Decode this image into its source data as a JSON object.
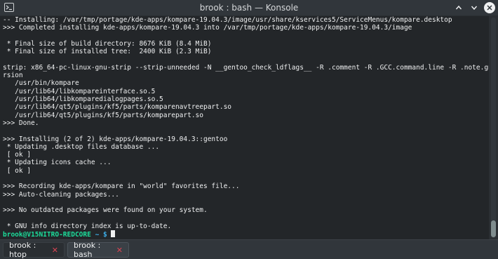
{
  "window": {
    "title": "brook : bash — Konsole"
  },
  "terminal": {
    "lines": [
      "-- Installing: /var/tmp/portage/kde-apps/kompare-19.04.3/image/usr/share/kservices5/ServiceMenus/kompare.desktop",
      ">>> Completed installing kde-apps/kompare-19.04.3 into /var/tmp/portage/kde-apps/kompare-19.04.3/image",
      "",
      " * Final size of build directory: 8676 KiB (8.4 MiB)",
      " * Final size of installed tree:  2400 KiB (2.3 MiB)",
      "",
      "strip: x86_64-pc-linux-gnu-strip --strip-unneeded -N __gentoo_check_ldflags__ -R .comment -R .GCC.command.line -R .note.gnu.gold-ve",
      "rsion",
      "   /usr/bin/kompare",
      "   /usr/lib64/libkompareinterface.so.5",
      "   /usr/lib64/libkomparedialogpages.so.5",
      "   /usr/lib64/qt5/plugins/kf5/parts/komparenavtreepart.so",
      "   /usr/lib64/qt5/plugins/kf5/parts/komparepart.so",
      ">>> Done.",
      "",
      ">>> Installing (2 of 2) kde-apps/kompare-19.04.3::gentoo",
      " * Updating .desktop files database ...",
      " [ ok ]",
      " * Updating icons cache ...",
      " [ ok ]",
      "",
      ">>> Recording kde-apps/kompare in \"world\" favorites file...",
      ">>> Auto-cleaning packages...",
      "",
      ">>> No outdated packages were found on your system.",
      "",
      " * GNU info directory index is up-to-date."
    ],
    "prompt": {
      "user_host": "brook@V15NITRO-REDCORE",
      "separator": " ~ $ "
    }
  },
  "tabs": [
    {
      "label": "brook : htop",
      "close": "✕"
    },
    {
      "label": "brook : bash",
      "close": "✕"
    }
  ],
  "colors": {
    "background": "#232629",
    "foreground": "#eff0f1",
    "prompt_user": "#1cdc9a",
    "prompt_dir": "#3daee9",
    "tab_close": "#da4453"
  },
  "icons": {
    "app": "konsole-terminal-icon",
    "keep_above": "chevron-up-icon",
    "minimize": "chevron-down-icon",
    "close": "close-icon"
  }
}
